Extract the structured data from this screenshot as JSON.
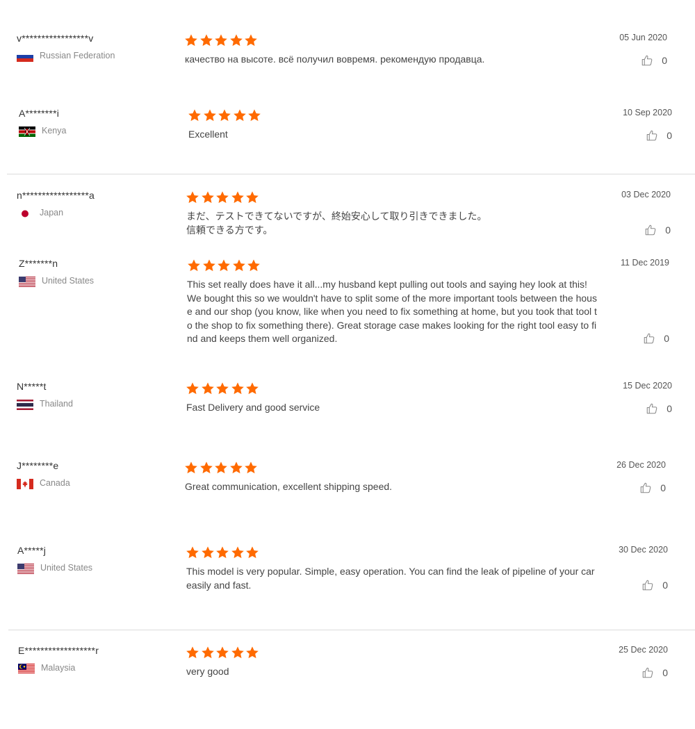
{
  "colors": {
    "star": "#ff6a00",
    "muted_text": "#888888",
    "divider": "#dcdcdc"
  },
  "icons": {
    "star": "star-icon",
    "like": "thumbs-up-icon"
  },
  "reviews": [
    {
      "name": "v*****************v",
      "country": "Russian Federation",
      "flag": "russia-flag-icon",
      "rating": 5,
      "text": "качество на высоте. всё получил вовремя. рекомендую продавца.",
      "date": "05 Jun 2020",
      "likes": "0"
    },
    {
      "name": "A********i",
      "country": "Kenya",
      "flag": "kenya-flag-icon",
      "rating": 5,
      "text": "Excellent",
      "date": "10 Sep 2020",
      "likes": "0"
    },
    {
      "name": "n*****************a",
      "country": "Japan",
      "flag": "japan-flag-icon",
      "rating": 5,
      "text": "まだ、テストできてないですが、終始安心して取り引きできました。\n信頼できる方です。",
      "date": "03 Dec 2020",
      "likes": "0"
    },
    {
      "name": "Z*******n",
      "country": "United States",
      "flag": "usa-flag-icon",
      "rating": 5,
      "text": "This set really does have it all...my husband kept pulling out tools and saying hey look at this! We bought this so we wouldn't have to split some of the more important tools between the house and our shop (you know, like when you need to fix something at home, but you took that tool to the shop to fix something there). Great storage case makes looking for the right tool easy to find and keeps them well organized.",
      "date": "11 Dec 2019",
      "likes": "0"
    },
    {
      "name": "N*****t",
      "country": "Thailand",
      "flag": "thailand-flag-icon",
      "rating": 5,
      "text": "Fast Delivery and good service",
      "date": "15 Dec 2020",
      "likes": "0"
    },
    {
      "name": "J********e",
      "country": "Canada",
      "flag": "canada-flag-icon",
      "rating": 5,
      "text": "Great communication, excellent shipping speed.",
      "date": "26 Dec 2020",
      "likes": "0"
    },
    {
      "name": "A*****j",
      "country": "United States",
      "flag": "usa-flag-icon",
      "rating": 5,
      "text": "This model is very popular. Simple, easy operation. You can find the leak of pipeline of your car easily and fast.",
      "date": "30 Dec 2020",
      "likes": "0"
    },
    {
      "name": "E******************r",
      "country": "Malaysia",
      "flag": "malaysia-flag-icon",
      "rating": 5,
      "text": "very good",
      "date": "25 Dec 2020",
      "likes": "0"
    }
  ]
}
